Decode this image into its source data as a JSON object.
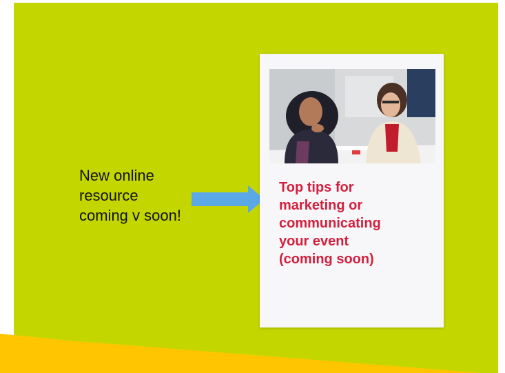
{
  "callout": {
    "lines": [
      "New online",
      "resource",
      "coming v soon!"
    ]
  },
  "card": {
    "title_lines": [
      "Top tips for",
      "marketing or",
      "communicating",
      "your event",
      "(coming soon)"
    ],
    "photo_icon": "photo-of-two-women-talking"
  },
  "colors": {
    "background": "#c4d600",
    "accent_band": "#ffc600",
    "arrow": "#5aa9e6",
    "card_title": "#d31f3d",
    "card_bg": "#f7f7f9"
  }
}
